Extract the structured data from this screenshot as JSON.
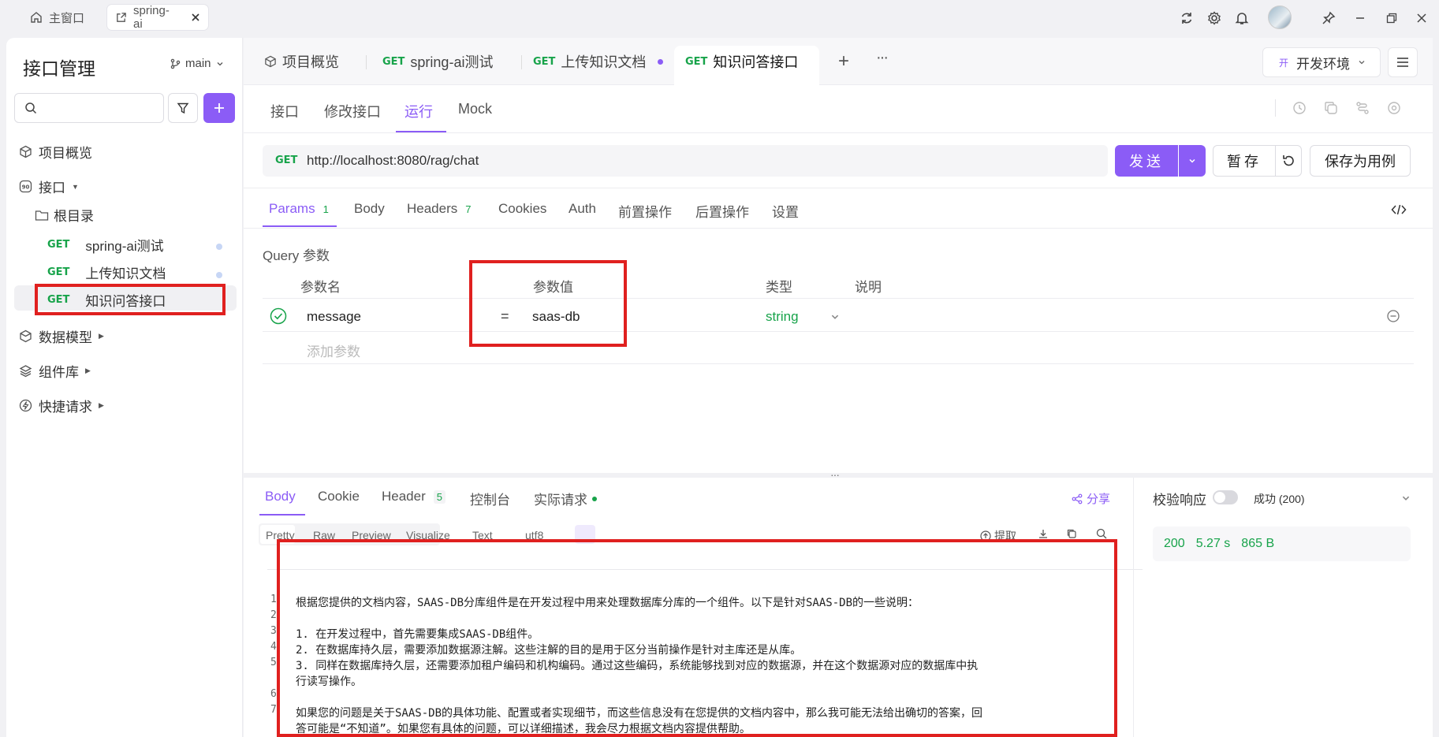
{
  "titlebar": {
    "home_tab": "主窗口",
    "project_tab": "spring-ai"
  },
  "sidebar": {
    "title": "接口管理",
    "branch": "main",
    "overview": "项目概览",
    "apis": "接口",
    "root": "根目录",
    "endpoints": [
      {
        "method": "GET",
        "name": "spring-ai测试"
      },
      {
        "method": "GET",
        "name": "上传知识文档"
      },
      {
        "method": "GET",
        "name": "知识问答接口"
      }
    ],
    "data_models": "数据模型",
    "components": "组件库",
    "quick_requests": "快捷请求"
  },
  "tabs": {
    "overview": "项目概览",
    "t1_method": "GET",
    "t1_name": "spring-ai测试",
    "t2_method": "GET",
    "t2_name": "上传知识文档",
    "t3_method": "GET",
    "t3_name": "知识问答接口",
    "add": "+",
    "more": "···"
  },
  "env": {
    "badge": "开",
    "name": "开发环境"
  },
  "subtabs": [
    "接口",
    "修改接口",
    "运行",
    "Mock"
  ],
  "request": {
    "method": "GET",
    "url": "http://localhost:8080/rag/chat",
    "send": "发送",
    "save_temp": "暂存",
    "save_case": "保存为用例"
  },
  "param_tabs": {
    "params": "Params",
    "params_count": "1",
    "body": "Body",
    "headers": "Headers",
    "headers_count": "7",
    "cookies": "Cookies",
    "auth": "Auth",
    "pre": "前置操作",
    "post": "后置操作",
    "settings": "设置"
  },
  "query": {
    "title": "Query 参数",
    "col_name": "参数名",
    "col_value": "参数值",
    "col_type": "类型",
    "col_desc": "说明",
    "row": {
      "name": "message",
      "eq": "=",
      "value": "saas-db",
      "type": "string"
    },
    "add_placeholder": "添加参数"
  },
  "response": {
    "tabs": {
      "body": "Body",
      "cookie": "Cookie",
      "header": "Header",
      "header_count": "5",
      "console": "控制台",
      "actual": "实际请求"
    },
    "share": "分享",
    "format": [
      "Pretty",
      "Raw",
      "Preview",
      "Visualize"
    ],
    "text_select": "Text",
    "enc_select": "utf8",
    "extract": "提取",
    "lines": [
      {
        "n": "1",
        "text": "根据您提供的文档内容，SAAS-DB分库组件是在开发过程中用来处理数据库分库的一个组件。以下是针对SAAS-DB的一些说明："
      },
      {
        "n": "2",
        "text": ""
      },
      {
        "n": "3",
        "text": "1. 在开发过程中，首先需要集成SAAS-DB组件。"
      },
      {
        "n": "4",
        "text": "2. 在数据库持久层，需要添加数据源注解。这些注解的目的是用于区分当前操作是针对主库还是从库。"
      },
      {
        "n": "5",
        "text": "3. 同样在数据库持久层，还需要添加租户编码和机构编码。通过这些编码，系统能够找到对应的数据源，并在这个数据源对应的数据库中执"
      },
      {
        "n": "",
        "text": "行读写操作。"
      },
      {
        "n": "6",
        "text": ""
      },
      {
        "n": "7",
        "text": "如果您的问题是关于SAAS-DB的具体功能、配置或者实现细节，而这些信息没有在您提供的文档内容中，那么我可能无法给出确切的答案，回"
      },
      {
        "n": "",
        "text": "答可能是“不知道”。如果您有具体的问题，可以详细描述，我会尽力根据文档内容提供帮助。"
      }
    ],
    "validate_label": "校验响应",
    "validate_status": "成功 (200)",
    "status_code": "200",
    "time": "5.27 s",
    "size": "865 B"
  },
  "colors": {
    "accent": "#8b5cf6",
    "get_green": "#17a34a",
    "annotation_red": "#e0201f"
  }
}
